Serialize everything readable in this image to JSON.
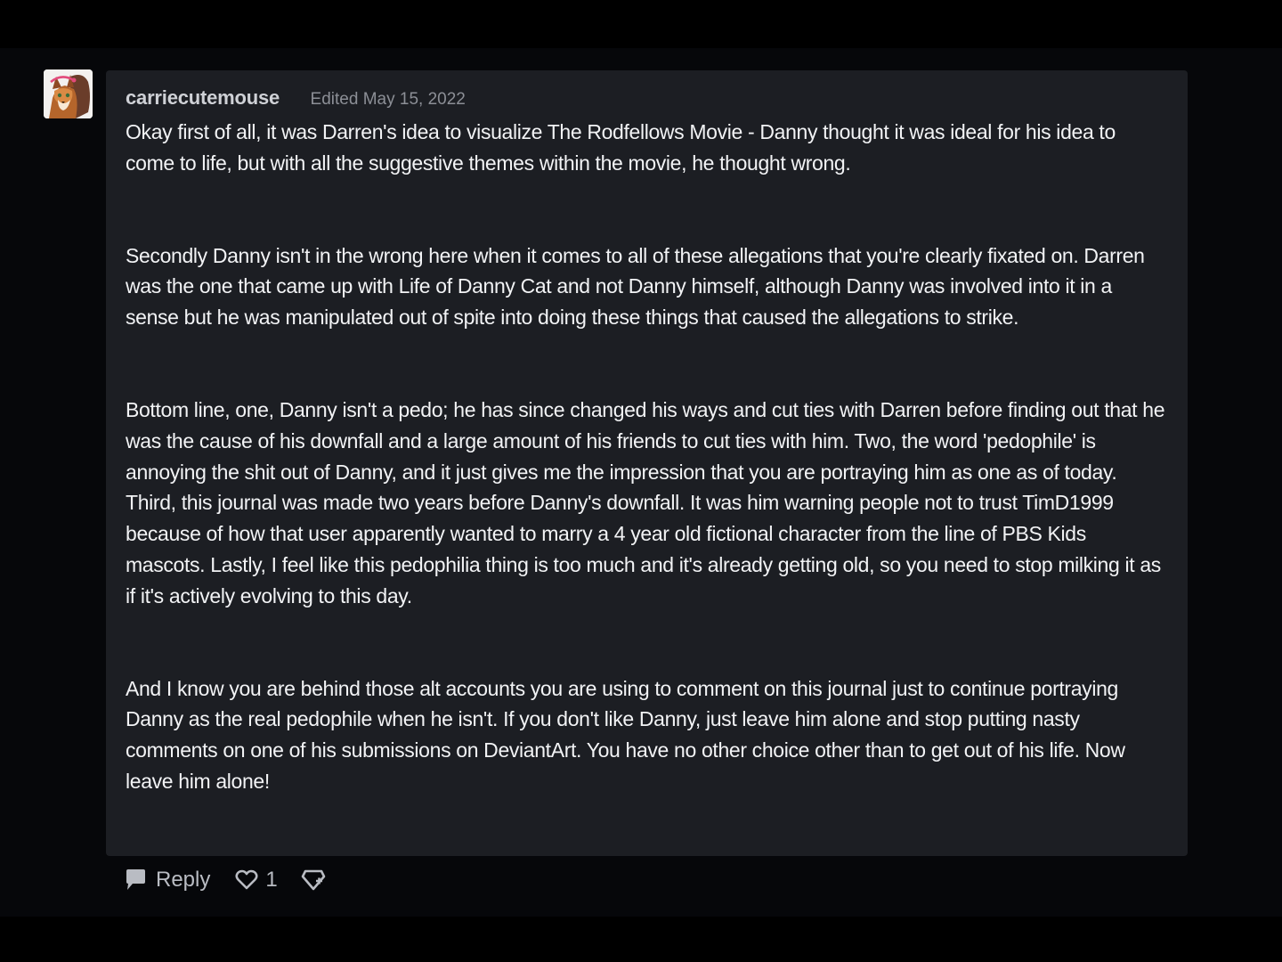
{
  "comment": {
    "avatar_icon": "fox-avatar-icon",
    "username": "carriecutemouse",
    "edited_label": "Edited May 15, 2022",
    "paragraphs": [
      "Okay first of all, it was Darren's idea to visualize The Rodfellows Movie - Danny thought it was ideal for his idea to come to life, but with all the suggestive themes within the movie, he thought wrong.",
      "Secondly Danny isn't in the wrong here when it comes to all of these allegations that you're clearly fixated on. Darren was the one that came up with Life of Danny Cat and not Danny himself, although Danny was involved into it in a sense but he was manipulated out of spite into doing these things that caused the allegations to strike.",
      "Bottom line, one, Danny isn't a pedo; he has since changed his ways and cut ties with Darren before finding out that he was the cause of his downfall and a large amount of his friends to cut ties with him. Two, the word 'pedophile' is annoying the shit out of Danny, and it just gives me the impression that you are portraying him as one as of today. Third, this journal was made two years before Danny's downfall. It was him warning people not to trust TimD1999 because of how that user apparently wanted to marry a 4 year old fictional character from the line of PBS Kids mascots. Lastly, I feel like this pedophilia thing is too much and it's already getting old, so you need to stop milking it as if it's actively evolving to this day.",
      "And I know you are behind those alt accounts you are using to comment on this journal just to continue portraying Danny as the real pedophile when he isn't. If you don't like Danny, just leave him alone and stop putting nasty comments on one of his submissions on DeviantArt. You have no other choice other than to get out of his life. Now leave him alone!"
    ]
  },
  "actions": {
    "reply_label": "Reply",
    "reply_icon": "speech-bubble-icon",
    "like_icon": "heart-icon",
    "like_count": "1",
    "award_icon": "award-badge-icon"
  },
  "colors": {
    "page_background": "#000000",
    "bubble_background": "#1c1e23",
    "body_text": "#f2f3f5",
    "meta_text": "#8c8f96",
    "action_text": "#b9bcc3"
  }
}
